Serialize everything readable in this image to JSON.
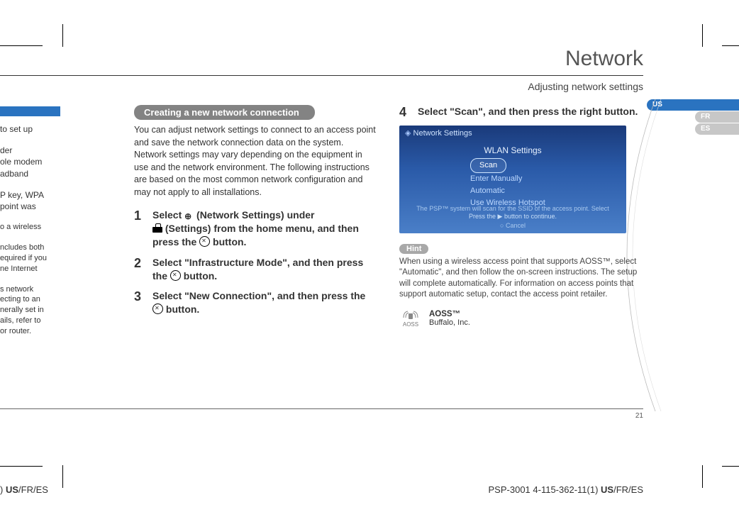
{
  "header": {
    "section_title": "Network",
    "subtitle": "Adjusting network settings"
  },
  "lang_tabs": {
    "us": "US",
    "fr": "FR",
    "es": "ES"
  },
  "left_fragments": {
    "l1": " to set up",
    "l2": "der\nole modem\nadband",
    "l3": "P key, WPA\npoint was",
    "l4": "o a wireless",
    "l5": "ncludes both\nequired if you\nne Internet",
    "l6": "s network\necting to an\nnerally set in\nails, refer to\n or router."
  },
  "col1": {
    "section_label": "Creating a new network connection",
    "intro": "You can adjust network settings to connect to an access point and save the network connection data on the system. Network settings may vary depending on the equipment in use and the network environment. The following instructions are based on the most common network configuration and may not apply to all installations.",
    "step1_a": "Select ",
    "step1_b": " (Network Settings) under ",
    "step1_c": " (Settings) from the home menu, and then press the ",
    "step1_d": " button.",
    "step2_a": "Select \"Infrastructure Mode\", and then press the ",
    "step2_b": " button.",
    "step3_a": "Select \"New Connection\", and then press the ",
    "step3_b": " button."
  },
  "col2": {
    "step4": "Select \"Scan\", and then press the right button.",
    "screenshot": {
      "title": "Network Settings",
      "heading": "WLAN Settings",
      "opt_scan": "Scan",
      "opt_manual": "Enter Manually",
      "opt_auto": "Automatic",
      "opt_hotspot": "Use Wireless Hotspot",
      "foot1": "The PSP™ system will scan for the SSID of the access point. Select",
      "foot2": "Press the ▶ button to continue.",
      "foot3": "○ Cancel"
    },
    "hint_label": "Hint",
    "hint_text": "When using a wireless access point that supports AOSS™, select \"Automatic\", and then follow the on-screen instructions. The setup will complete automatically. For information on access points that support automatic setup, contact the access point retailer.",
    "aoss_label": "AOSS",
    "aoss_name": "AOSS™",
    "aoss_company": "Buffalo, Inc."
  },
  "page_number": "21",
  "footer": {
    "left_prefix": ") ",
    "left_bold": "US",
    "left_rest": "/FR/ES",
    "right_code": "PSP-3001 4-115-362-11(1) ",
    "right_bold": "US",
    "right_rest": "/FR/ES"
  }
}
